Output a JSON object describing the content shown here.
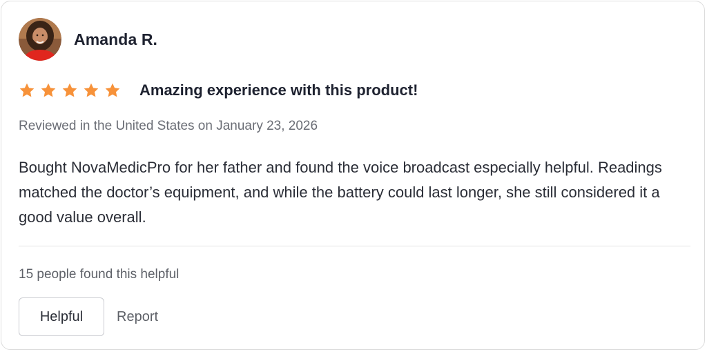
{
  "reviewer": {
    "name": "Amanda R.",
    "avatar_icon": "user-avatar-photo"
  },
  "rating": {
    "stars": 5,
    "max_stars": 5,
    "star_color": "#f7923a",
    "star_icon": "star-icon"
  },
  "review": {
    "title": "Amazing experience with this product!",
    "meta": "Reviewed in the United States on January 23, 2026",
    "body": "Bought NovaMedicPro for her father and found the voice broadcast especially helpful. Readings matched the doctor’s equipment, and while the battery could last longer, she still considered it a good value overall."
  },
  "footer": {
    "helpful_count_text": "15 people found this helpful",
    "helpful_button_label": "Helpful",
    "report_label": "Report"
  },
  "colors": {
    "text_primary": "#1e2230",
    "text_secondary": "#6a6d75",
    "border": "#dcdcdc"
  }
}
